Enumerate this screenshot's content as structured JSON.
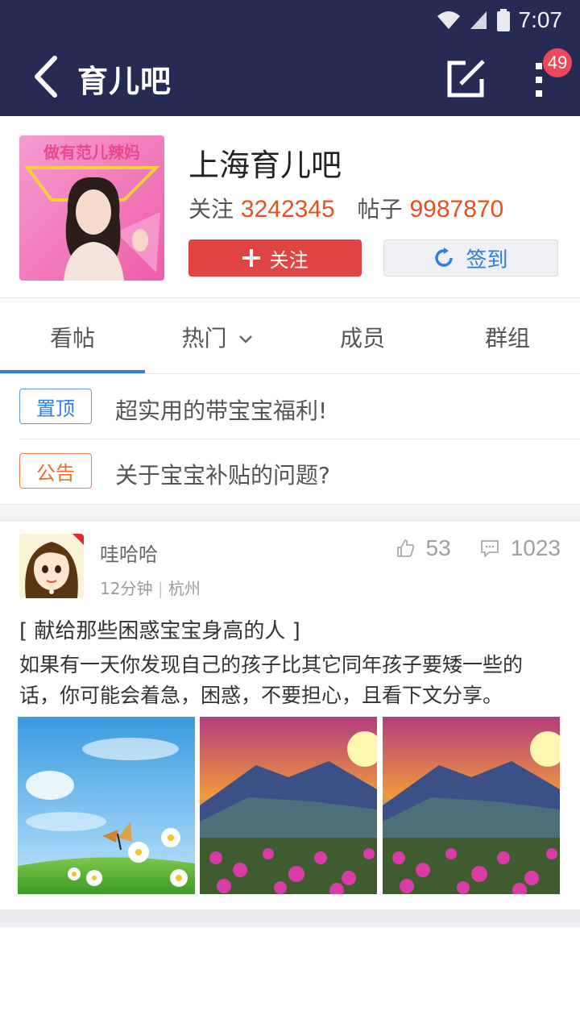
{
  "status_bar": {
    "time": "7:07"
  },
  "header": {
    "title": "育儿吧",
    "badge_count": "49",
    "icons": [
      "back-arrow-icon",
      "edit-icon",
      "more-vertical-icon"
    ]
  },
  "forum": {
    "name": "上海育儿吧",
    "followers_label": "关注",
    "followers": "3242345",
    "posts_label": "帖子",
    "posts": "9987870",
    "follow_button": "关注",
    "checkin_button": "签到",
    "banner_text": "做有范儿辣妈"
  },
  "tabs": [
    {
      "label": "看帖",
      "active": true
    },
    {
      "label": "热门",
      "active": false
    },
    {
      "label": "成员",
      "active": false
    },
    {
      "label": "群组",
      "active": false
    }
  ],
  "pinned": [
    {
      "tag": "置顶",
      "text": "超实用的带宝宝福利!"
    },
    {
      "tag": "公告",
      "text": "关于宝宝补贴的问题?"
    }
  ],
  "post": {
    "author": "哇哈哈",
    "time": "12分钟",
    "location": "杭州",
    "likes": "53",
    "comments": "1023",
    "title": "[ 献给那些困惑宝宝身高的人 ]",
    "body": "如果有一天你发现自己的孩子比其它同年孩子要矮一些的话，你可能会着急，困惑，不要担心，且看下文分享。",
    "images": [
      "butterfly-flowers-sky-image",
      "mountain-sunset-flowers-image",
      "mountain-sunset-flowers-image"
    ]
  },
  "colors": {
    "header_bg": "#252b52",
    "follow_red": "#e04543",
    "accent_blue": "#2f7de1",
    "number_orange": "#e8501e",
    "badge_red": "#f0465a"
  }
}
